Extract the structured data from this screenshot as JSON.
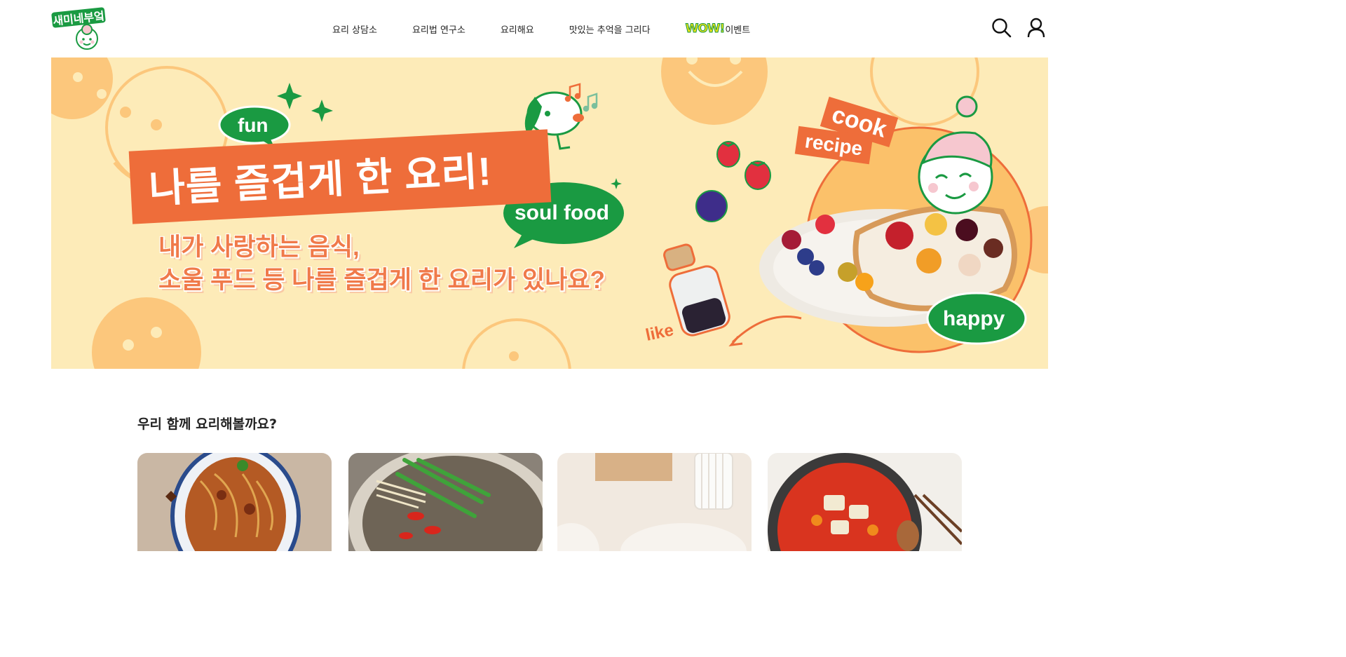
{
  "header": {
    "logo_text": "새미네부엌",
    "nav": [
      {
        "label": "요리 상담소"
      },
      {
        "label": "요리법 연구소"
      },
      {
        "label": "요리해요"
      },
      {
        "label": "맛있는 추억을 그리다"
      },
      {
        "label": "이벤트",
        "badge": "WOW!"
      }
    ],
    "icons": {
      "search": "search-icon",
      "user": "user-icon"
    }
  },
  "banner": {
    "fun_bubble": "fun",
    "headline": "나를 즐겁게 한 요리!",
    "soul_bubble": "soul food",
    "subline1": "내가 사랑하는 음식,",
    "subline2": "소울 푸드 등 나를 즐겁게 한 요리가 있나요?",
    "tag_cook": "cook",
    "tag_recipe": "recipe",
    "happy_bubble": "happy",
    "like_label": "like",
    "colors": {
      "background": "#fdebb8",
      "accent": "#ee6d3a",
      "green": "#1a9a42",
      "smiley": "#fcc77c"
    }
  },
  "section": {
    "title": "우리 함께 요리해볼까요?",
    "cards": [
      {
        "dish": "noodle-stir-fry-image"
      },
      {
        "dish": "beef-soup-hotpot-image"
      },
      {
        "dish": "kitchen-plate-image"
      },
      {
        "dish": "kimchi-stew-image"
      }
    ]
  }
}
